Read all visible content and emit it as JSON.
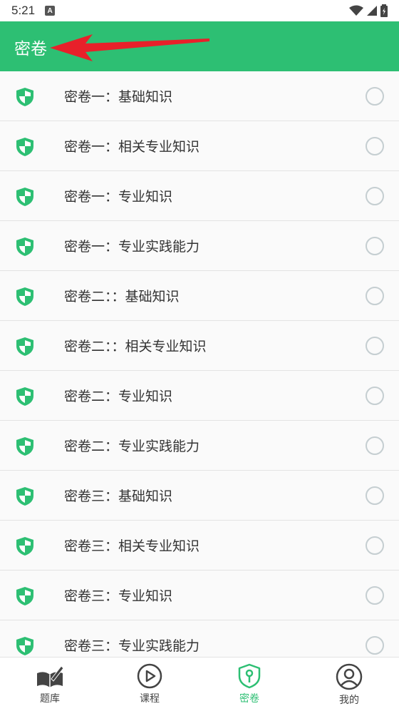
{
  "status_bar": {
    "time": "5:21",
    "notification_badge": "A"
  },
  "app_bar": {
    "title": "密卷",
    "accent_color": "#2dbf73",
    "annotation_arrow_color": "#e8202a"
  },
  "papers": [
    {
      "label": "密卷一：基础知识"
    },
    {
      "label": "密卷一：相关专业知识"
    },
    {
      "label": "密卷一：专业知识"
    },
    {
      "label": "密卷一：专业实践能力"
    },
    {
      "label": "密卷二：：基础知识"
    },
    {
      "label": "密卷二：：相关专业知识"
    },
    {
      "label": "密卷二：专业知识"
    },
    {
      "label": "密卷二：专业实践能力"
    },
    {
      "label": "密卷三：基础知识"
    },
    {
      "label": "密卷三：相关专业知识"
    },
    {
      "label": "密卷三：专业知识"
    },
    {
      "label": "密卷三：专业实践能力"
    }
  ],
  "bottom_nav": {
    "items": [
      {
        "label": "题库",
        "icon": "book-pen-icon"
      },
      {
        "label": "课程",
        "icon": "play-circle-icon"
      },
      {
        "label": "密卷",
        "icon": "shield-key-icon",
        "active": true
      },
      {
        "label": "我的",
        "icon": "user-circle-icon"
      }
    ]
  }
}
